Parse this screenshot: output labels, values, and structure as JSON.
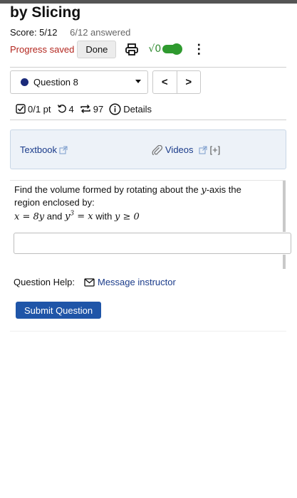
{
  "page": {
    "title": "by Slicing",
    "score": "Score: 5/12",
    "answered": "6/12 answered",
    "progress_saved": "Progress saved",
    "done_label": "Done",
    "math_toggle_label": "√0"
  },
  "question_nav": {
    "selected": "Question 8",
    "prev": "<",
    "next": ">"
  },
  "meta": {
    "points": "0/1 pt",
    "retries": "4",
    "attempts": "97",
    "details": "Details"
  },
  "resources": {
    "textbook": "Textbook",
    "videos": "Videos",
    "more": "[+]"
  },
  "question": {
    "line1a": "Find the volume formed by rotating about the ",
    "line1var": "y",
    "line1b": "-axis the",
    "line2": "region enclosed by:",
    "eq1": "x = 8y",
    "and": " and ",
    "eq2_base": "y",
    "eq2_exp": "3",
    "eq2_rest": " = x",
    "with": " with ",
    "eq3": "y ≥ 0"
  },
  "help": {
    "label": "Question Help:",
    "message": "Message instructor"
  },
  "submit_label": "Submit Question",
  "colors": {
    "progress": "#b3261e",
    "accent": "#1f55a8",
    "link": "#1a3b8a",
    "toggle": "#2f9a2f"
  },
  "icons": [
    "printer-icon",
    "math-toggle-icon",
    "kebab-menu-icon",
    "checkbox-icon",
    "retry-icon",
    "attempts-icon",
    "info-icon",
    "external-link-icon",
    "paperclip-icon",
    "mail-icon"
  ]
}
